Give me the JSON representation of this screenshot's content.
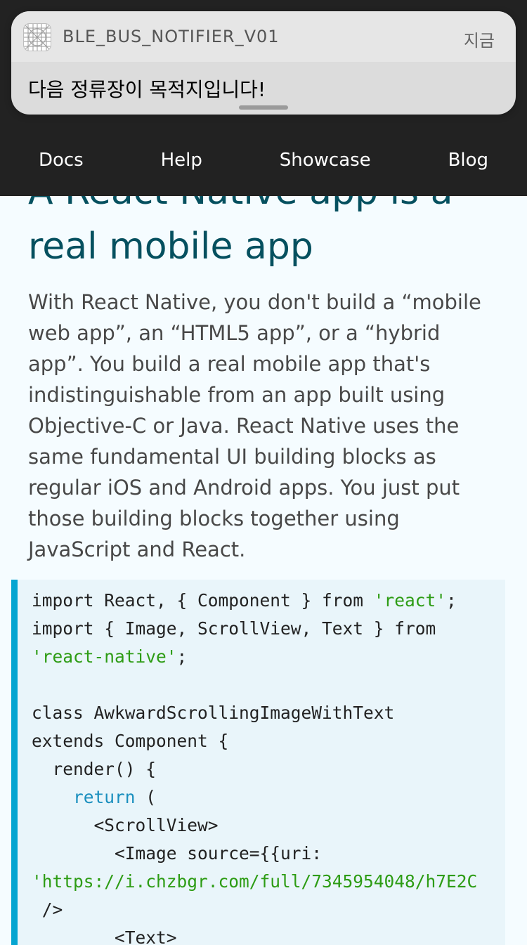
{
  "notification": {
    "app_name": "BLE_BUS_NOTIFIER_V01",
    "time": "지금",
    "message": "다음 정류장이 목적지입니다!"
  },
  "nav": {
    "items": [
      {
        "label": "Docs"
      },
      {
        "label": "Help"
      },
      {
        "label": "Showcase"
      },
      {
        "label": "Blog"
      }
    ]
  },
  "hero": {
    "title": "A React Native app is a real mobile app",
    "description": "With React Native, you don't build a “mobile web app”, an “HTML5 app”, or a “hybrid app”. You build a real mobile app that's indistinguishable from an app built using Objective-C or Java. React Native uses the same fundamental UI building blocks as regular iOS and Android apps. You just put those building blocks together using JavaScript and React."
  },
  "code": {
    "l1a": "import React, { Component } from ",
    "l1s": "'react'",
    "l1b": ";",
    "l2": "import { Image, ScrollView, Text } from",
    "l3s": "'react-native'",
    "l3b": ";",
    "l5": "class AwkwardScrollingImageWithText",
    "l6": "extends Component {",
    "l7": "  render() {",
    "l8k": "return",
    "l8b": " (",
    "l9": "      <ScrollView>",
    "l10": "        <Image source={{uri:",
    "l11s": "'https://i.chzbgr.com/full/7345954048/h7E2C",
    "l12": " />",
    "l13": "        <Text>"
  },
  "colors": {
    "navbar": "#222222",
    "title": "#05505f",
    "code_border": "#05a5d1",
    "code_bg": "#e9f5fa",
    "string": "#2d9c14",
    "keyword": "#1a8fbe"
  }
}
